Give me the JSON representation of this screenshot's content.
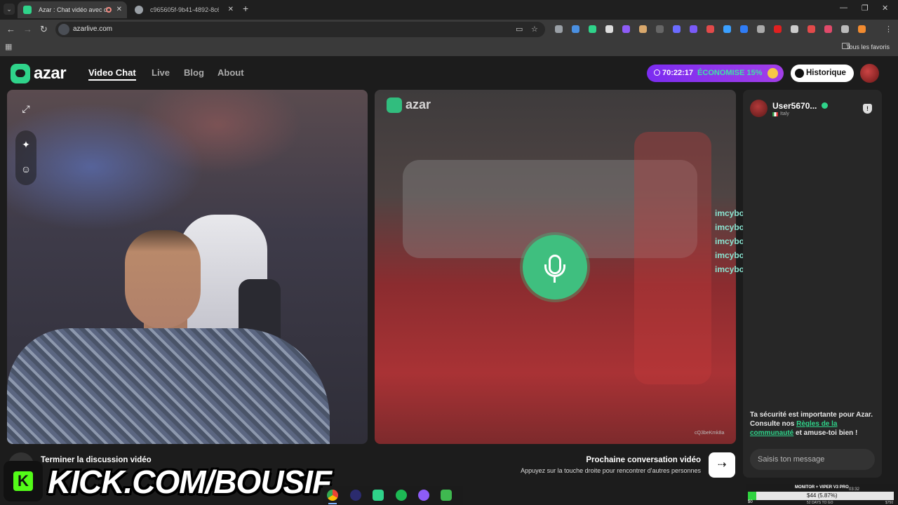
{
  "browser": {
    "tabs": [
      {
        "title": "Azar : Chat vidéo avec de n",
        "favicon_color": "#2fd38a"
      },
      {
        "title": "c965605f-9b41-4892-8c64-cbl",
        "favicon_color": "#9aa0a6"
      }
    ],
    "new_tab": "+",
    "url": "azarlive.com",
    "bookmarks_folder": "Tous les favoris",
    "extension_colors": [
      "#9aa0a6",
      "#4a90e2",
      "#2fd38a",
      "#dddddd",
      "#8e5cf7",
      "#d9a86c",
      "#666666",
      "#6b6bff",
      "#7a5af8",
      "#e24a4a",
      "#3ba0ff",
      "#2f7cf6",
      "#aaaaaa",
      "#e02020",
      "#cccccc",
      "#e24a4a",
      "#e04a6a",
      "#bbbbbb",
      "#f28b30"
    ]
  },
  "app": {
    "logo": "azar",
    "nav": [
      "Video Chat",
      "Live",
      "Blog",
      "About"
    ],
    "promo": {
      "timer": "70:22:17",
      "text": "ÉCONOMISE 15%"
    },
    "history_button": "Historique",
    "colors": {
      "accent": "#2fd38a",
      "promo": "#8a35ee",
      "mic": "#3fbf7f"
    }
  },
  "video": {
    "partner_logo": "azar",
    "partner_id": "cQ3beKmk8a",
    "tools": [
      "expand-icon",
      "sparkle-icon",
      "emoji-icon"
    ]
  },
  "chat_overlay": [
    {
      "user": "imcybo:",
      "text": "h"
    },
    {
      "user": "imcybo:",
      "text": "h"
    },
    {
      "user": "imcybo:",
      "text": "h"
    },
    {
      "user": "imcybo:",
      "text": "h"
    },
    {
      "user": "imcybo:",
      "text": "h"
    }
  ],
  "panel": {
    "username": "User5670...",
    "country": "Italy",
    "safety_text": "Ta sécurité est importante pour Azar. Consulte nos",
    "safety_link": "Règles de la communauté",
    "safety_end": "et amuse-toi bien !",
    "message_placeholder": "Saisis ton message"
  },
  "bottom": {
    "end_label": "Terminer la discussion vidéo",
    "next_title": "Prochaine conversation vidéo",
    "next_subtitle": "Appuyez sur la touche droite pour rencontrer d'autres personnes"
  },
  "overlay": {
    "kick_text": "KICK.COM/BOUSIF",
    "kick_letter": "K"
  },
  "monitor": {
    "label": "MONITOR + VIPER V3 PRO",
    "value": "$44 (5.87%)",
    "progress_percent": 5.87,
    "min": "$0",
    "mid": "52 DAYS TO GO",
    "max": "$750",
    "time": "03:32"
  }
}
